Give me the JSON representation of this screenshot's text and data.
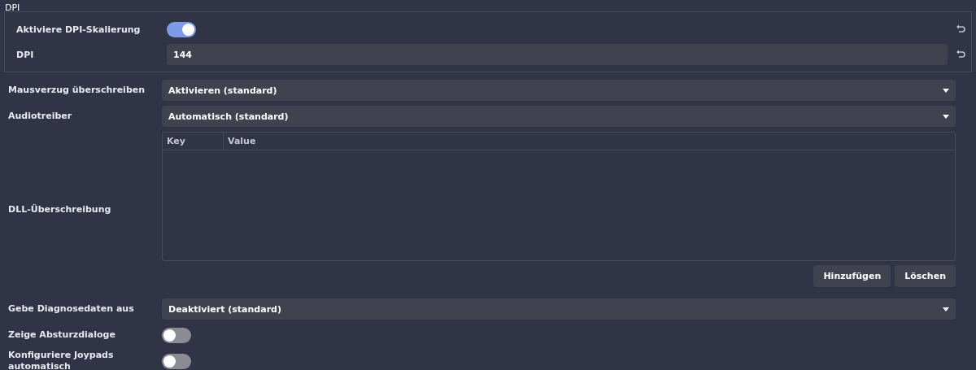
{
  "dpi_group": {
    "title": "DPI",
    "rows": [
      {
        "kind": "toggle",
        "label": "Aktiviere DPI-Skalierung",
        "on": true
      },
      {
        "kind": "field",
        "label": "DPI",
        "value": "144"
      }
    ]
  },
  "settings": [
    {
      "kind": "dropdown",
      "label": "Mausverzug überschreiben",
      "value": "Aktivieren (standard)"
    },
    {
      "kind": "dropdown",
      "label": "Audiotreiber",
      "value": "Automatisch (standard)"
    },
    {
      "kind": "table",
      "label": "DLL-Überschreibung",
      "columns": [
        "Key",
        "Value"
      ],
      "buttons": [
        "Hinzufügen",
        "Löschen"
      ]
    },
    {
      "kind": "dropdown",
      "label": "Gebe Diagnosedaten aus",
      "value": "Deaktiviert (standard)"
    },
    {
      "kind": "toggle",
      "label": "Zeige Absturzdialoge",
      "on": false
    },
    {
      "kind": "toggle",
      "label": "Konfiguriere Joypads automatisch",
      "on": false
    }
  ]
}
